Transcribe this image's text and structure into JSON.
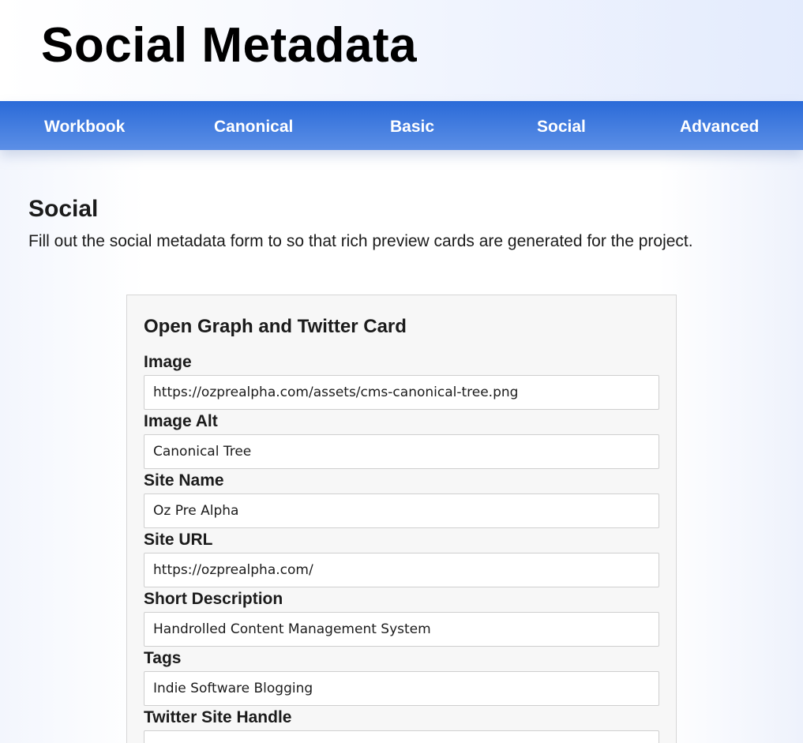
{
  "header": {
    "title": "Social Metadata"
  },
  "nav": {
    "items": [
      {
        "label": "Workbook"
      },
      {
        "label": "Canonical"
      },
      {
        "label": "Basic"
      },
      {
        "label": "Social"
      },
      {
        "label": "Advanced"
      }
    ]
  },
  "main": {
    "heading": "Social",
    "description": "Fill out the social metadata form to so that rich preview cards are generated for the project."
  },
  "form": {
    "title": "Open Graph and Twitter Card",
    "fields": [
      {
        "label": "Image",
        "value": "https://ozprealpha.com/assets/cms-canonical-tree.png"
      },
      {
        "label": "Image Alt",
        "value": "Canonical Tree"
      },
      {
        "label": "Site Name",
        "value": "Oz Pre Alpha"
      },
      {
        "label": "Site URL",
        "value": "https://ozprealpha.com/"
      },
      {
        "label": "Short Description",
        "value": "Handrolled Content Management System"
      },
      {
        "label": "Tags",
        "value": "Indie Software Blogging"
      },
      {
        "label": "Twitter Site Handle",
        "value": ""
      }
    ]
  },
  "colors": {
    "nav_top": "#2a6ad8",
    "nav_bottom": "#5c8fe6",
    "card_background": "#f7f7f7"
  }
}
